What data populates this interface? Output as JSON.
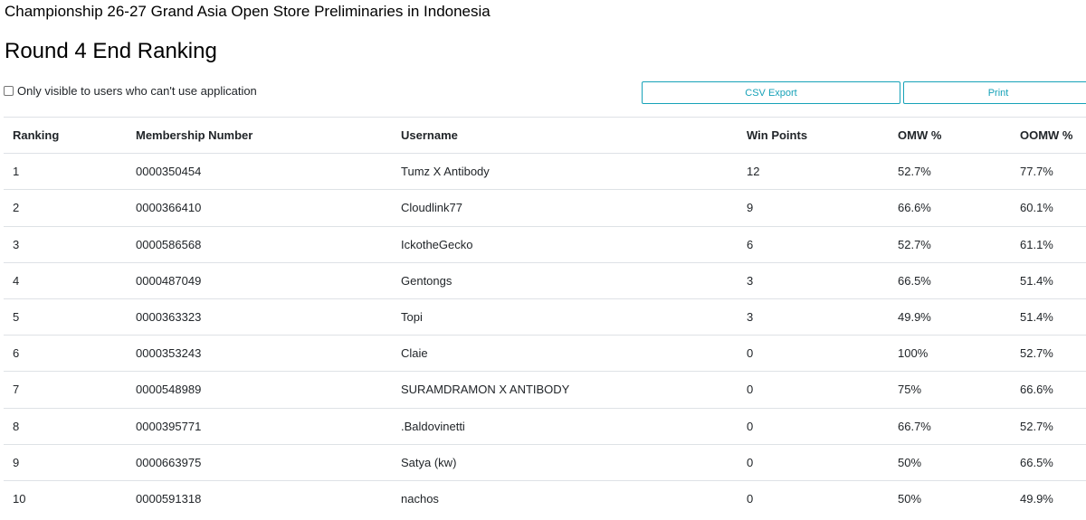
{
  "header": {
    "event_title": "Championship 26-27 Grand Asia Open Store Preliminaries in Indonesia",
    "round_title": "Round 4 End Ranking"
  },
  "filter": {
    "label": "Only visible to users who can't use application",
    "checked": false
  },
  "toolbar": {
    "csv_label": "CSV Export",
    "print_label": "Print"
  },
  "table": {
    "columns": [
      "Ranking",
      "Membership Number",
      "Username",
      "Win Points",
      "OMW %",
      "OOMW %"
    ],
    "rows": [
      [
        "1",
        "0000350454",
        "Tumz X Antibody",
        "12",
        "52.7%",
        "77.7%"
      ],
      [
        "2",
        "0000366410",
        "Cloudlink77",
        "9",
        "66.6%",
        "60.1%"
      ],
      [
        "3",
        "0000586568",
        "IckotheGecko",
        "6",
        "52.7%",
        "61.1%"
      ],
      [
        "4",
        "0000487049",
        "Gentongs",
        "3",
        "66.5%",
        "51.4%"
      ],
      [
        "5",
        "0000363323",
        "Topi",
        "3",
        "49.9%",
        "51.4%"
      ],
      [
        "6",
        "0000353243",
        "Claie",
        "0",
        "100%",
        "52.7%"
      ],
      [
        "7",
        "0000548989",
        "SURAMDRAMON X ANTIBODY",
        "0",
        "75%",
        "66.6%"
      ],
      [
        "8",
        "0000395771",
        ".Baldovinetti",
        "0",
        "66.7%",
        "52.7%"
      ],
      [
        "9",
        "0000663975",
        "Satya (kw)",
        "0",
        "50%",
        "66.5%"
      ],
      [
        "10",
        "0000591318",
        "nachos",
        "0",
        "50%",
        "49.9%"
      ]
    ]
  },
  "colors": {
    "accent": "#17a2b8",
    "border": "#dee2e6",
    "text": "#212529"
  }
}
